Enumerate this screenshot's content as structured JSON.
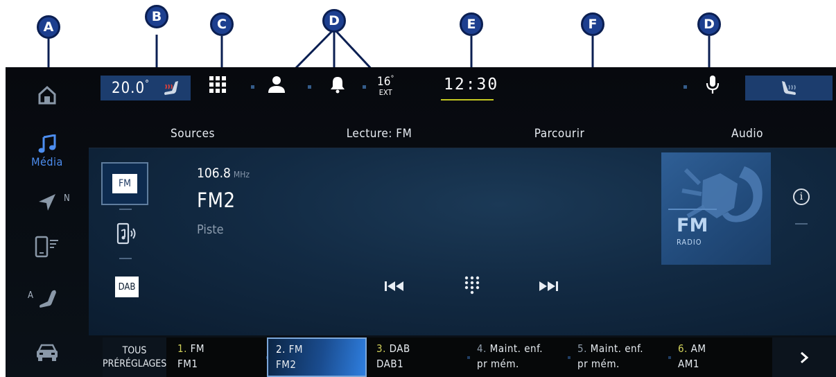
{
  "callouts": [
    "A",
    "B",
    "C",
    "D",
    "E",
    "F",
    "D"
  ],
  "rail": {
    "items": [
      {
        "name": "home",
        "icon": "home-icon"
      },
      {
        "name": "media",
        "icon": "music-note-icon",
        "label": "Média",
        "active": true
      },
      {
        "name": "navigation",
        "icon": "navigation-arrow-icon",
        "sup": "N"
      },
      {
        "name": "phone",
        "icon": "phone-projection-icon"
      },
      {
        "name": "drive-mode",
        "icon": "seat-adjust-icon",
        "sup": "A"
      },
      {
        "name": "vehicle",
        "icon": "car-icon"
      }
    ]
  },
  "status": {
    "temperature": "20.0",
    "temperature_unit": "°",
    "ext_temp": "16",
    "ext_temp_unit": "°",
    "ext_label": "EXT",
    "clock": "12:30",
    "accent": "#c4c821"
  },
  "tabs": [
    {
      "label": "Sources"
    },
    {
      "label": "Lecture: FM",
      "active": true
    },
    {
      "label": "Parcourir"
    },
    {
      "label": "Audio"
    }
  ],
  "sources": {
    "fm_label": "FM",
    "dab_label": "DAB"
  },
  "player": {
    "frequency": "106.8",
    "frequency_unit": "MHz",
    "station": "FM2",
    "track": "Piste",
    "art_title": "FM",
    "art_subtitle": "RADIO"
  },
  "presets": {
    "all_line1": "TOUS",
    "all_line2": "PRÉRÉGLAGES",
    "items": [
      {
        "num": "1.",
        "band": "FM",
        "name": "FM1"
      },
      {
        "num": "2.",
        "band": "FM",
        "name": "FM2",
        "active": true
      },
      {
        "num": "3.",
        "band": "DAB",
        "name": "DAB1"
      },
      {
        "num": "4.",
        "band": "Maint. enf.",
        "name": "pr mém."
      },
      {
        "num": "5.",
        "band": "Maint. enf.",
        "name": "pr mém."
      },
      {
        "num": "6.",
        "band": "AM",
        "name": "AM1"
      }
    ]
  },
  "colors": {
    "marker_fill": "#1d3f8f",
    "active_blue": "#4d8ef0",
    "panel": "#122a43"
  }
}
